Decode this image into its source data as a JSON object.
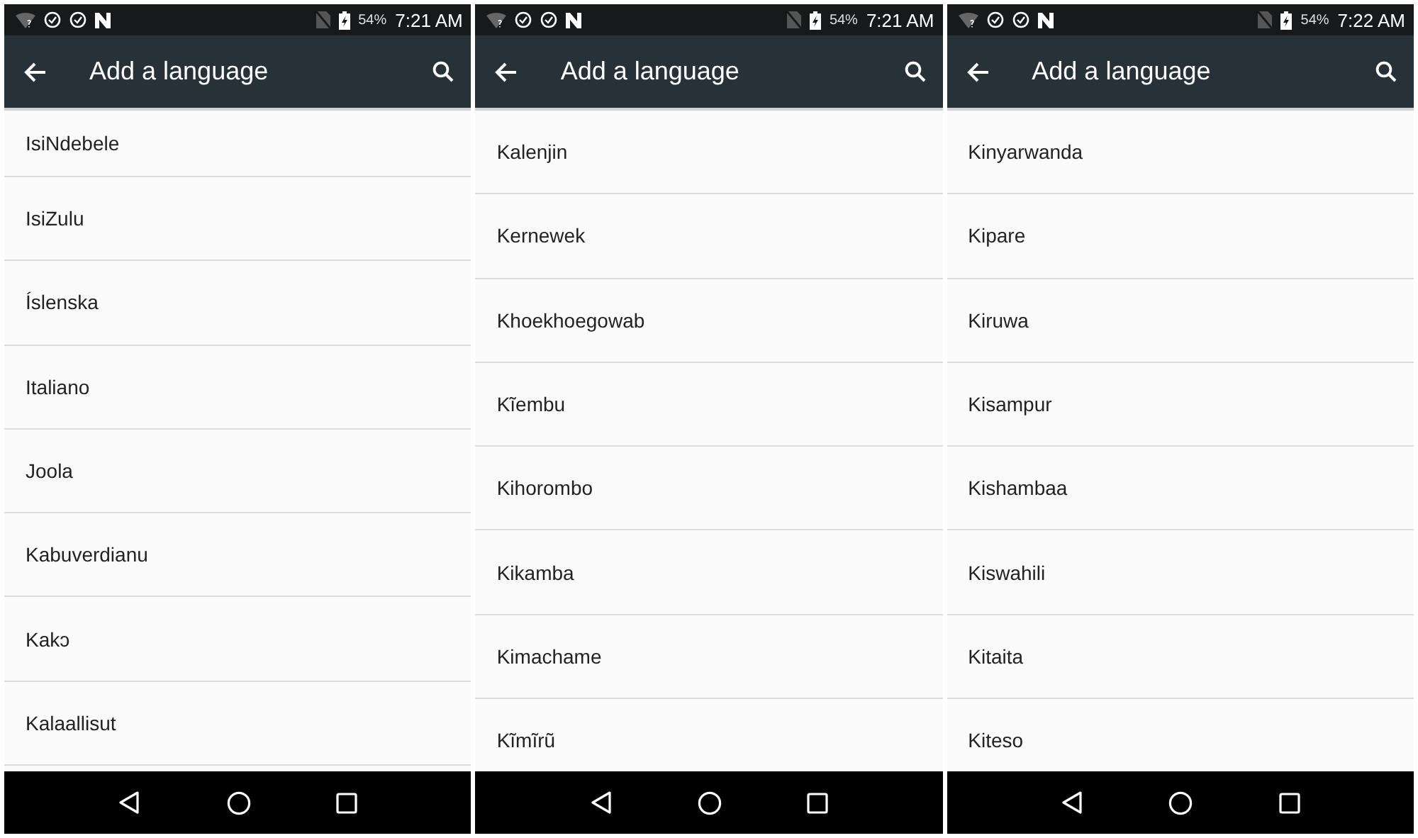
{
  "screens": [
    {
      "status_bar": {
        "battery": "54%",
        "time": "7:21 AM"
      },
      "toolbar": {
        "title": "Add a language"
      },
      "languages": [
        "IsiNdebele",
        "IsiZulu",
        "Íslenska",
        "Italiano",
        "Joola",
        "Kabuverdianu",
        "Kakɔ",
        "Kalaallisut"
      ]
    },
    {
      "status_bar": {
        "battery": "54%",
        "time": "7:21 AM"
      },
      "toolbar": {
        "title": "Add a language"
      },
      "languages": [
        "Kalenjin",
        "Kernewek",
        "Khoekhoegowab",
        "Kĩembu",
        "Kihorombo",
        "Kikamba",
        "Kimachame",
        "Kĩmĩrũ"
      ]
    },
    {
      "status_bar": {
        "battery": "54%",
        "time": "7:22 AM"
      },
      "toolbar": {
        "title": "Add a language"
      },
      "languages": [
        "Kinyarwanda",
        "Kipare",
        "Kiruwa",
        "Kisampur",
        "Kishambaa",
        "Kiswahili",
        "Kitaita",
        "Kiteso"
      ]
    }
  ]
}
